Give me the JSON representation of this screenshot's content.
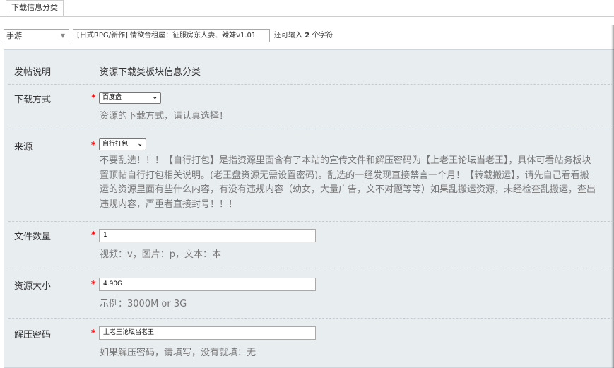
{
  "tab": {
    "label": "下载信息分类"
  },
  "type_select": {
    "value": "手游"
  },
  "title_field": {
    "value": "[日式RPG/新作] 情欲合租屋：征服房东人妻、辣妹v1.01"
  },
  "char_hint": {
    "prefix": "还可输入",
    "count": "2",
    "suffix": "个字符"
  },
  "panel": {
    "intro": {
      "label": "发帖说明",
      "value": "资源下载类板块信息分类"
    },
    "download_method": {
      "label": "下载方式",
      "required": "*",
      "value": "百度盘",
      "hint": "资源的下载方式，请认真选择！"
    },
    "source": {
      "label": "来源",
      "required": "*",
      "value": "自行打包",
      "desc_lines": [
        "不要乱选！！！【自行打包】是指资源里面含有了本站的宣传文件和解压密码为【上老王论坛当老王】，具体可看站务板块",
        "置顶帖自行打包相关说明。(老王盘资源无需设置密码)。乱选的一经发现直接禁言一个月！【转载搬运】，请先自己看看搬",
        "运的资源里面有些什么内容，有没有违规内容（幼女，大量广告，文不对题等等）如果乱搬运资源，未经检查乱搬运，查出",
        "违规内容，严重者直接封号！！！"
      ]
    },
    "file_count": {
      "label": "文件数量",
      "required": "*",
      "value": "1",
      "hint": "视频：v，图片：p，文本：本"
    },
    "size": {
      "label": "资源大小",
      "required": "*",
      "value": "4.90G",
      "hint": "示例：3000M or 3G"
    },
    "password": {
      "label": "解压密码",
      "required": "*",
      "value": "上老王论坛当老王",
      "hint": "如果解压密码，请填写，没有就填：无"
    }
  }
}
